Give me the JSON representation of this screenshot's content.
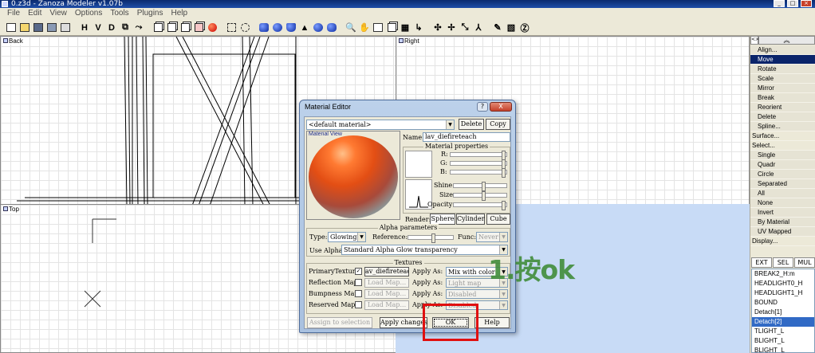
{
  "window": {
    "title": "0.z3d - Zanoza Modeler v1.07b"
  },
  "menu": [
    "File",
    "Edit",
    "View",
    "Options",
    "Tools",
    "Plugins",
    "Help"
  ],
  "toolbar": {
    "letters": [
      "H",
      "V",
      "D"
    ],
    "icons": [
      "new-file-icon",
      "open-folder-icon",
      "save-icon",
      "save-all-icon",
      "print-icon",
      "hierarchy-icon",
      "cube-icon",
      "ball-icon",
      "select-box-icon",
      "zoom-icon",
      "pan-icon",
      "help-icon"
    ]
  },
  "viewports": {
    "back": "Back",
    "right": "Right",
    "top": "Top"
  },
  "command_panel": {
    "toggle_label": "<>",
    "items": [
      {
        "label": "Align...",
        "type": "item"
      },
      {
        "label": "Move",
        "type": "item",
        "selected": true
      },
      {
        "label": "Rotate",
        "type": "item"
      },
      {
        "label": "Scale",
        "type": "item"
      },
      {
        "label": "Mirror",
        "type": "item"
      },
      {
        "label": "Break",
        "type": "item"
      },
      {
        "label": "Reorient",
        "type": "item"
      },
      {
        "label": "Delete",
        "type": "item"
      },
      {
        "label": "Spline...",
        "type": "item"
      },
      {
        "label": "Surface...",
        "type": "header"
      },
      {
        "label": "Select...",
        "type": "header"
      },
      {
        "label": "Single",
        "type": "item"
      },
      {
        "label": "Quadr",
        "type": "item"
      },
      {
        "label": "Circle",
        "type": "item"
      },
      {
        "label": "Separated",
        "type": "item"
      },
      {
        "label": "All",
        "type": "item"
      },
      {
        "label": "None",
        "type": "item"
      },
      {
        "label": "Invert",
        "type": "item"
      },
      {
        "label": "By Material",
        "type": "item"
      },
      {
        "label": "UV Mapped",
        "type": "item"
      },
      {
        "label": "Display...",
        "type": "header"
      }
    ],
    "tabs": [
      "EXT",
      "SEL",
      "MUL"
    ],
    "objects": [
      {
        "label": "BREAK2_H:m"
      },
      {
        "label": "HEADLIGHT0_H"
      },
      {
        "label": "HEADLIGHT1_H"
      },
      {
        "label": "BOUND"
      },
      {
        "label": "Detach[1]"
      },
      {
        "label": "Detach[2]",
        "selected": true
      },
      {
        "label": "TLIGHT_L"
      },
      {
        "label": "BLIGHT_L"
      },
      {
        "label": "BLIGHT_L"
      }
    ]
  },
  "material_editor": {
    "title": "Material Editor",
    "help_btn": "?",
    "close_btn": "X",
    "material_select": "<default material>",
    "delete_btn": "Delete",
    "copy_btn": "Copy",
    "preview_label": "Material View",
    "name_label": "Name:",
    "name_value": "lav_diefireteach",
    "props_title": "Material properties",
    "r_label": "R:",
    "g_label": "G:",
    "b_label": "B:",
    "shine_label": "Shine:",
    "size_label": "Size:",
    "opacity_label": "Opacity:",
    "render_label": "Render:",
    "render_options": [
      "Sphere",
      "Cylinder",
      "Cube"
    ],
    "render_selected": "Sphere",
    "alpha_title": "Alpha parameters",
    "type_label": "Type:",
    "type_value": "Glowing",
    "reference_label": "Reference:",
    "func_label": "Func:",
    "func_value": "Never",
    "use_alpha_label": "Use Alpha:",
    "use_alpha_value": "Standard Alpha Glow transparency",
    "textures_title": "Textures",
    "textures": [
      {
        "label": "PrimaryTexture",
        "checked": true,
        "file": "av_diefireteach",
        "apply_label": "Apply As:",
        "apply_value": "Mix with color"
      },
      {
        "label": "Reflection Map",
        "checked": false,
        "file": "Load Map...",
        "apply_label": "Apply As:",
        "apply_value": "Light map"
      },
      {
        "label": "Bumpness Map",
        "checked": false,
        "file": "Load Map...",
        "apply_label": "Apply As:",
        "apply_value": "Disabled"
      },
      {
        "label": "Reserved Map",
        "checked": false,
        "file": "Load Map...",
        "apply_label": "Apply As:",
        "apply_value": "Disabled"
      }
    ],
    "assign_btn": "Assign to selection",
    "apply_btn": "Apply changes",
    "ok_btn": "OK",
    "help_label": "Help"
  },
  "annotation": {
    "text": "1.按ok",
    "color": "#3f8c3a",
    "box_color": "#e01010"
  }
}
